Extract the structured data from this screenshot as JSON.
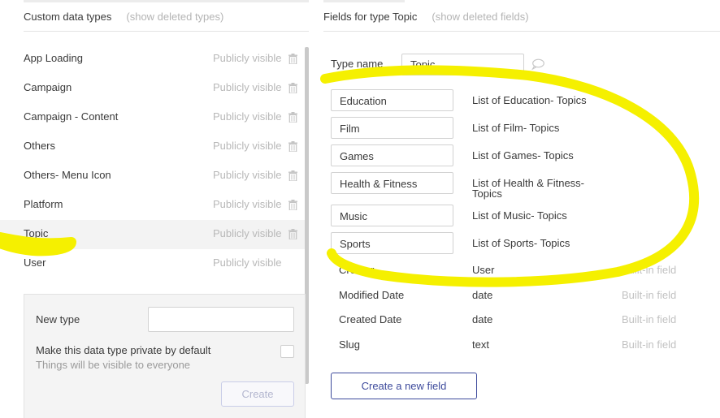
{
  "left_panel": {
    "title": "Custom data types",
    "show_deleted_link": "(show deleted types)",
    "types": [
      {
        "name": "App Loading",
        "visibility": "Publicly visible",
        "deletable": true,
        "selected": false
      },
      {
        "name": "Campaign",
        "visibility": "Publicly visible",
        "deletable": true,
        "selected": false
      },
      {
        "name": "Campaign - Content",
        "visibility": "Publicly visible",
        "deletable": true,
        "selected": false
      },
      {
        "name": "Others",
        "visibility": "Publicly visible",
        "deletable": true,
        "selected": false
      },
      {
        "name": "Others- Menu Icon",
        "visibility": "Publicly visible",
        "deletable": true,
        "selected": false
      },
      {
        "name": "Platform",
        "visibility": "Publicly visible",
        "deletable": true,
        "selected": false
      },
      {
        "name": "Topic",
        "visibility": "Publicly visible",
        "deletable": true,
        "selected": true
      },
      {
        "name": "User",
        "visibility": "Publicly visible",
        "deletable": false,
        "selected": false
      }
    ],
    "new_type": {
      "label": "New type",
      "input_value": "",
      "private_label": "Make this data type private by default",
      "private_checked": false,
      "hint": "Things will be visible to everyone",
      "create_button": "Create"
    }
  },
  "right_panel": {
    "title": "Fields for type Topic",
    "show_deleted_link": "(show deleted fields)",
    "type_name_label": "Type name",
    "type_name_value": "Topic",
    "fields": [
      {
        "name": "Education",
        "type": "List of Education- Topics"
      },
      {
        "name": "Film",
        "type": "List of Film- Topics"
      },
      {
        "name": "Games",
        "type": "List of Games- Topics"
      },
      {
        "name": "Health & Fitness",
        "type_line1": "List of Health & Fitness-",
        "type_line2": "Topics"
      },
      {
        "name": "Music",
        "type": "List of Music- Topics"
      },
      {
        "name": "Sports",
        "type": "List of Sports- Topics"
      }
    ],
    "builtin_fields": [
      {
        "name": "Creator",
        "type": "User",
        "tag": "Built-in field"
      },
      {
        "name": "Modified Date",
        "type": "date",
        "tag": "Built-in field"
      },
      {
        "name": "Created Date",
        "type": "date",
        "tag": "Built-in field"
      },
      {
        "name": "Slug",
        "type": "text",
        "tag": "Built-in field"
      }
    ],
    "create_field_button": "Create a new field"
  },
  "colors": {
    "highlight_annotation": "#f5f000",
    "primary_button_border": "#3d4a9c",
    "muted_text": "#b8b8b8"
  },
  "icons": {
    "trash": "trash-icon",
    "comment": "comment-icon"
  }
}
